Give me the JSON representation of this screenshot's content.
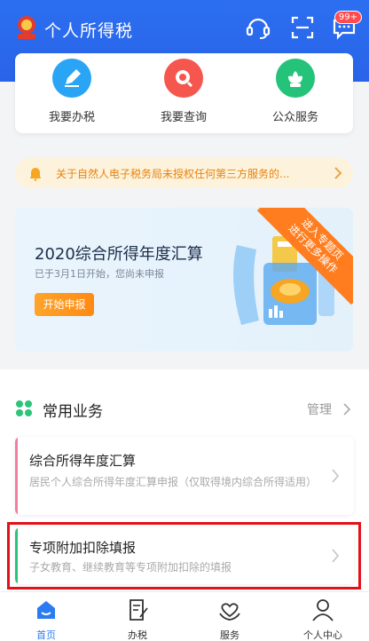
{
  "header": {
    "title": "个人所得税",
    "badge": "99+"
  },
  "quick": [
    {
      "label": "我要办税",
      "color": "#2aa4f4"
    },
    {
      "label": "我要查询",
      "color": "#f5564d"
    },
    {
      "label": "公众服务",
      "color": "#25c27a"
    }
  ],
  "notice": {
    "text": "关于自然人电子税务局未授权任何第三方服务的..."
  },
  "banner": {
    "title": "2020综合所得年度汇算",
    "subtitle": "已于3月1日开始，您尚未申报",
    "button": "开始申报",
    "ribbon_line1": "进入专题页",
    "ribbon_line2": "进行更多操作"
  },
  "section": {
    "title": "常用业务",
    "manage": "管理",
    "items": [
      {
        "title": "综合所得年度汇算",
        "desc": "居民个人综合所得年度汇算申报（仅取得境内综合所得适用）",
        "color": "#f27ea0"
      },
      {
        "title": "专项附加扣除填报",
        "desc": "子女教育、继续教育等专项附加扣除的填报",
        "color": "#28c47c"
      }
    ]
  },
  "nav": [
    {
      "label": "首页",
      "active": true
    },
    {
      "label": "办税",
      "active": false
    },
    {
      "label": "服务",
      "active": false
    },
    {
      "label": "个人中心",
      "active": false
    }
  ],
  "colors": {
    "primary": "#2b6ff0",
    "accent_orange": "#ff8a14",
    "highlight_red": "#e21219"
  }
}
